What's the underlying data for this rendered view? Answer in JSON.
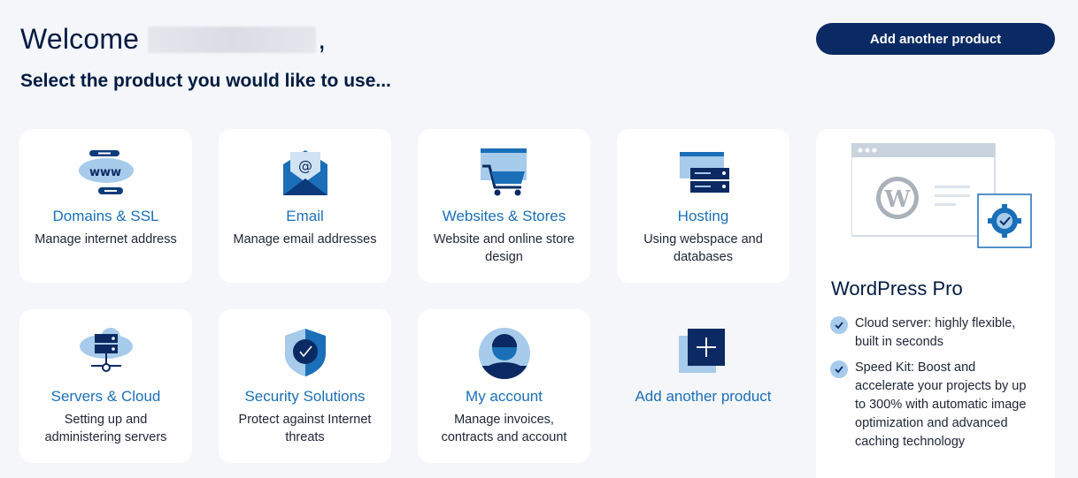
{
  "header": {
    "welcome": "Welcome",
    "comma": ",",
    "subtitle": "Select the product you would like to use...",
    "add_button": "Add another product"
  },
  "products": [
    {
      "title": "Domains & SSL",
      "desc": "Manage internet address",
      "icon": "www-icon"
    },
    {
      "title": "Email",
      "desc": "Manage email addresses",
      "icon": "email-icon"
    },
    {
      "title": "Websites & Stores",
      "desc": "Website and online store design",
      "icon": "shopping-cart-icon"
    },
    {
      "title": "Hosting",
      "desc": "Using webspace and databases",
      "icon": "server-icon"
    },
    {
      "title": "Servers & Cloud",
      "desc": "Setting up and administering servers",
      "icon": "cloud-server-icon"
    },
    {
      "title": "Security Solutions",
      "desc": "Protect against Internet threats",
      "icon": "shield-icon"
    },
    {
      "title": "My account",
      "desc": "Manage invoices, contracts and account",
      "icon": "user-icon"
    }
  ],
  "add_tile": {
    "title": "Add another product",
    "icon": "plus-icon"
  },
  "promo": {
    "title": "WordPress Pro",
    "features": [
      "Cloud server: highly flexible, built in seconds",
      "Speed Kit: Boost and accelerate your projects by up to 300% with automatic image optimization and advanced caching technology"
    ]
  },
  "colors": {
    "primary": "#0b2a63",
    "link": "#1a6fb8",
    "background": "#f4f6fa"
  }
}
